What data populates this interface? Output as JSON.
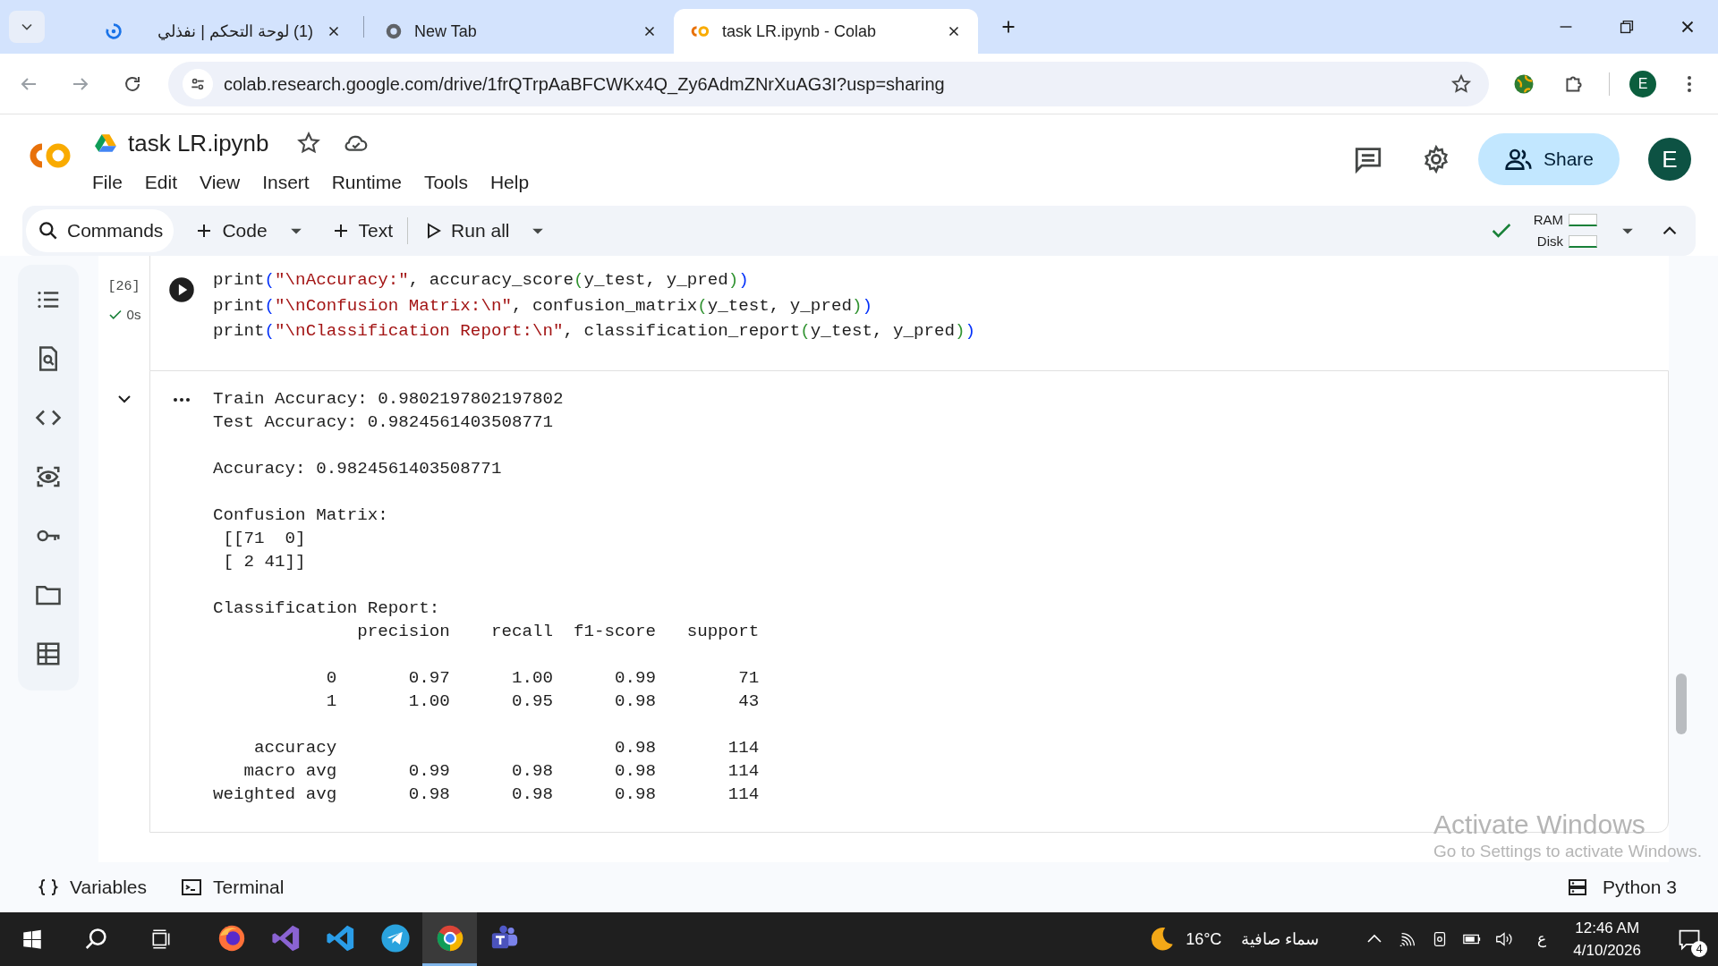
{
  "browser": {
    "tabs": [
      {
        "title": "(1) لوحة التحكم | نفذلي",
        "selected": false
      },
      {
        "title": "New Tab",
        "selected": false
      },
      {
        "title": "task LR.ipynb - Colab",
        "selected": true
      }
    ],
    "url": "colab.research.google.com/drive/1frQTrpAaBFCWKx4Q_Zy6AdmZNrXuAG3I?usp=sharing",
    "profile": "E"
  },
  "notebook": {
    "title": "task LR.ipynb",
    "menu": [
      "File",
      "Edit",
      "View",
      "Insert",
      "Runtime",
      "Tools",
      "Help"
    ],
    "share": "Share",
    "avatar": "E"
  },
  "toolbar": {
    "commands": "Commands",
    "code": "Code",
    "text": "Text",
    "run_all": "Run all",
    "ram": "RAM",
    "disk": "Disk"
  },
  "cell": {
    "execution_count": "[26]",
    "duration": "0s",
    "code": [
      "print(\"\\nAccuracy:\", accuracy_score(y_test, y_pred))",
      "print(\"\\nConfusion Matrix:\\n\", confusion_matrix(y_test, y_pred))",
      "print(\"\\nClassification Report:\\n\", classification_report(y_test, y_pred))"
    ],
    "output": [
      [
        "Train Accuracy: 0.9802197802197802",
        "Test Accuracy: 0.9824561403508771"
      ],
      [
        "Accuracy: 0.9824561403508771"
      ],
      [
        "Confusion Matrix:",
        " [[71  0]",
        " [ 2 41]]"
      ],
      [
        "Classification Report:",
        "              precision    recall  f1-score   support"
      ],
      [
        "           0       0.97      1.00      0.99        71",
        "           1       1.00      0.95      0.98        43"
      ],
      [
        "    accuracy                           0.98       114",
        "   macro avg       0.99      0.98      0.98       114",
        "weighted avg       0.98      0.98      0.98       114"
      ]
    ]
  },
  "status_bar": {
    "variables": "Variables",
    "terminal": "Terminal",
    "runtime": "Python 3"
  },
  "activation": {
    "title": "Activate Windows",
    "hint": "Go to Settings to activate Windows."
  },
  "taskbar": {
    "apps": [
      {
        "kind": "firefox",
        "active": false
      },
      {
        "kind": "studio",
        "active": false
      },
      {
        "kind": "vscode",
        "active": false
      },
      {
        "kind": "telegram",
        "active": false
      },
      {
        "kind": "chrome",
        "active": true
      },
      {
        "kind": "teams",
        "active": false
      }
    ],
    "temperature": "16°C",
    "weather": "سماء صافية",
    "input_language": "ع",
    "time": "12:46 AM",
    "date": "4/10/2026",
    "notifications": "4"
  }
}
